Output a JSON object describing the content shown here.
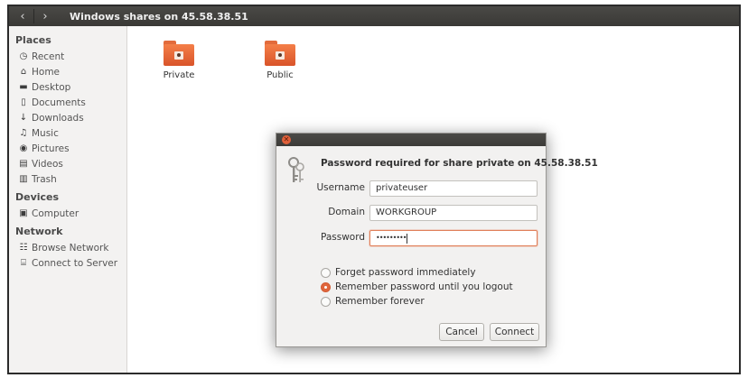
{
  "window": {
    "title": "Windows shares on 45.58.38.51",
    "nav": {
      "back_icon": "chevron-left-icon",
      "forward_icon": "chevron-right-icon"
    }
  },
  "sidebar": {
    "sections": [
      {
        "title": "Places",
        "items": [
          {
            "label": "Recent",
            "icon": "clock-icon"
          },
          {
            "label": "Home",
            "icon": "home-icon"
          },
          {
            "label": "Desktop",
            "icon": "desktop-folder-icon"
          },
          {
            "label": "Documents",
            "icon": "document-icon"
          },
          {
            "label": "Downloads",
            "icon": "download-icon"
          },
          {
            "label": "Music",
            "icon": "music-icon"
          },
          {
            "label": "Pictures",
            "icon": "camera-icon"
          },
          {
            "label": "Videos",
            "icon": "film-icon"
          },
          {
            "label": "Trash",
            "icon": "trash-icon"
          }
        ]
      },
      {
        "title": "Devices",
        "items": [
          {
            "label": "Computer",
            "icon": "computer-icon"
          }
        ]
      },
      {
        "title": "Network",
        "items": [
          {
            "label": "Browse Network",
            "icon": "network-icon"
          },
          {
            "label": "Connect to Server",
            "icon": "server-icon"
          }
        ]
      }
    ]
  },
  "shares": [
    {
      "label": "Private",
      "icon": "shared-folder-icon"
    },
    {
      "label": "Public",
      "icon": "shared-folder-icon"
    }
  ],
  "dialog": {
    "heading": "Password required for share private on 45.58.38.51",
    "fields": {
      "username": {
        "label": "Username",
        "value": "privateuser"
      },
      "domain": {
        "label": "Domain",
        "value": "WORKGROUP"
      },
      "password": {
        "label": "Password",
        "value": "•••••••••"
      }
    },
    "options": [
      {
        "label": "Forget password immediately",
        "checked": false
      },
      {
        "label": "Remember password until you logout",
        "checked": true
      },
      {
        "label": "Remember forever",
        "checked": false
      }
    ],
    "buttons": {
      "cancel": "Cancel",
      "connect": "Connect"
    },
    "colors": {
      "accent": "#e0663c",
      "titlebar": "#3c3b38"
    }
  }
}
